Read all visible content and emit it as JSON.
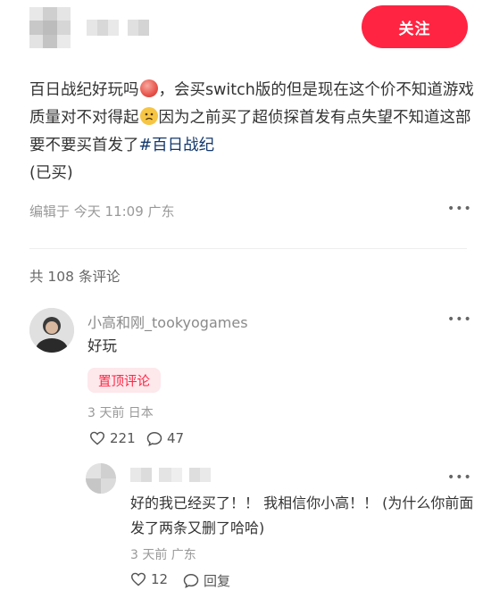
{
  "header": {
    "follow_label": "关注"
  },
  "post": {
    "text": "百日战纪好玩吗",
    "text2": "，会买switch版的但是现在这个价不知道游戏质量对不对得起",
    "text3": "因为之前买了超侦探首发有点失望不知道这部要不要买首发了",
    "hashtag": "#百日战纪",
    "text4": "(已买)",
    "meta": "编辑于 今天 11:09 广东"
  },
  "comments": {
    "count_label": "共 108 条评论",
    "top": {
      "username": "小高和刚_tookyogames",
      "text": "好玩",
      "badge": "置顶评论",
      "meta": "3 天前 日本",
      "likes": "221",
      "replies": "47"
    },
    "reply": {
      "text": "好的我已经买了！！ 我相信你小高！！ (为什么你前面发了两条又删了哈哈)",
      "meta": "3 天前 广东",
      "likes": "12",
      "reply_label": "回复"
    }
  },
  "icons": {
    "more": "more-dots-icon",
    "like": "heart-icon",
    "comment": "comment-bubble-icon",
    "emoji1": "peach-emoji-icon",
    "emoji2": "sad-face-emoji-icon"
  },
  "colors": {
    "accent": "#ff2442",
    "hashtag": "#13386c",
    "badge_bg": "#fde8ec"
  }
}
